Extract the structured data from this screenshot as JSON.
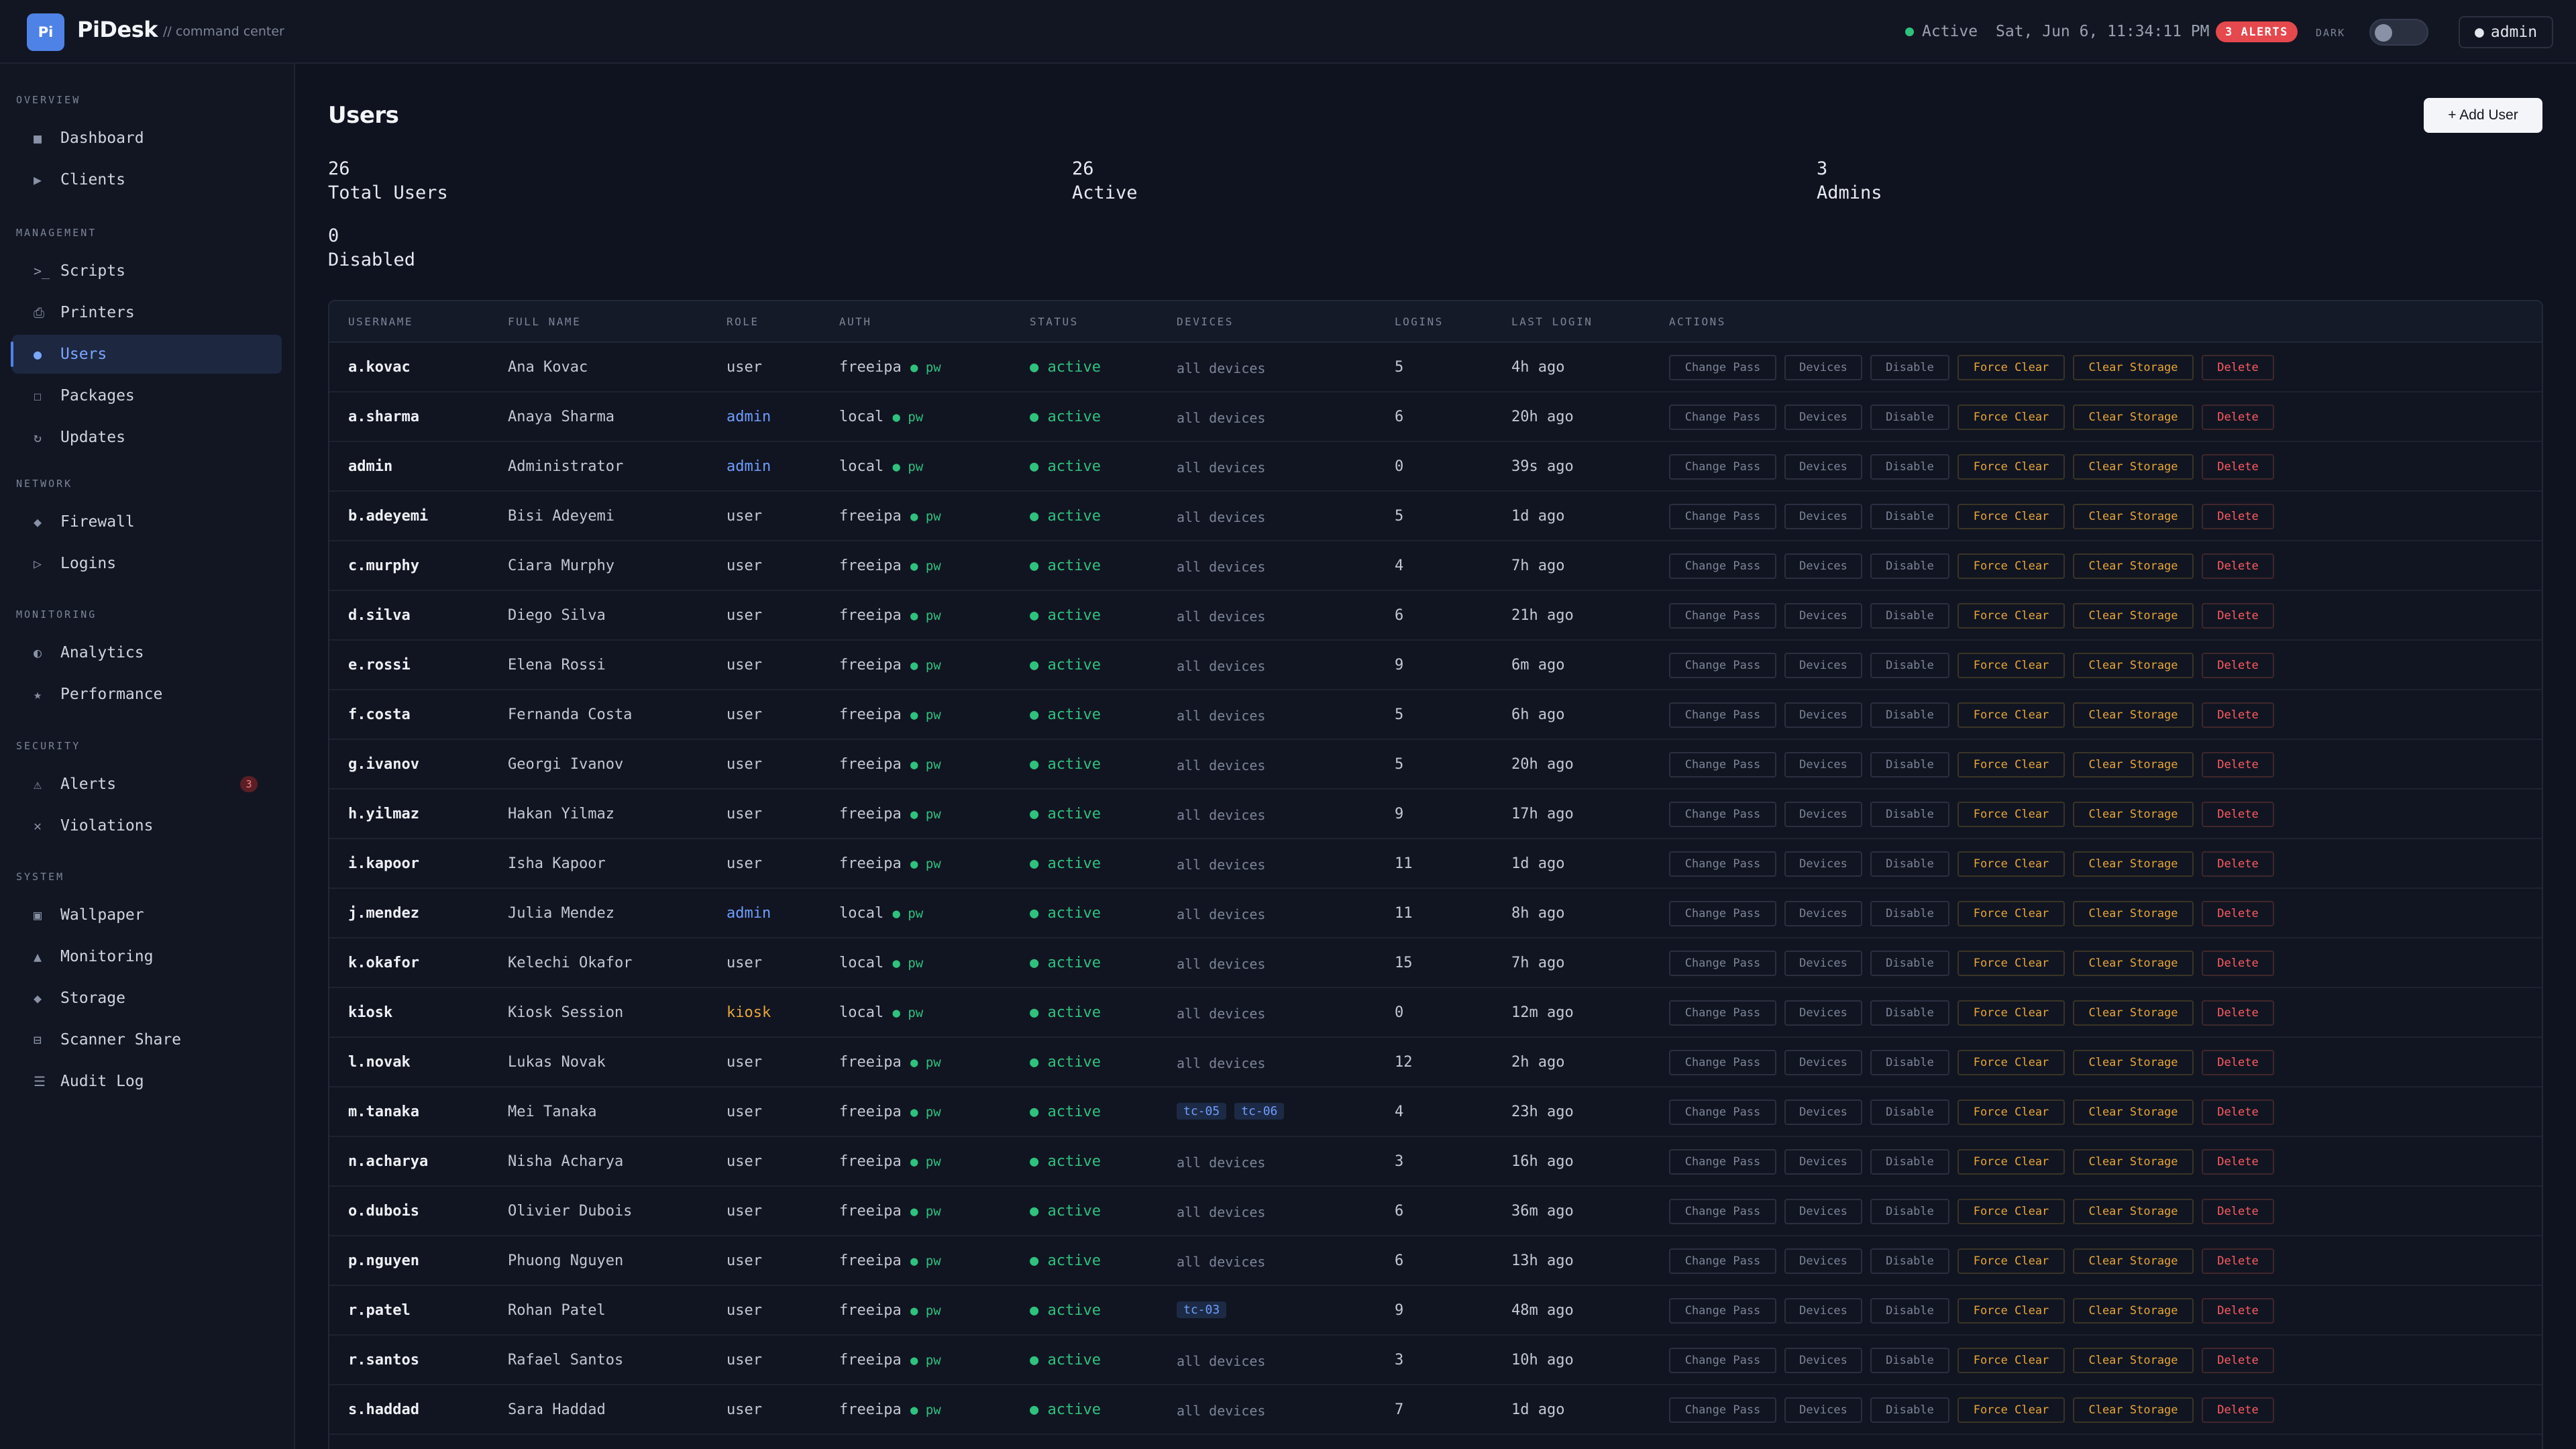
{
  "app": {
    "logo_text": "Pi",
    "brand": "PiDesk",
    "subtitle": "// command center",
    "status": "Active",
    "datetime": "Sat, Jun 6, 11:34:11 PM",
    "alerts_badge": "3 ALERTS",
    "theme_label": "DARK",
    "user_chip": "admin"
  },
  "colors": {
    "accent": "#4f82e6",
    "active_green": "#2ec27e",
    "admin_blue": "#6f9eff",
    "kiosk_orange": "#e8a63a",
    "danger_red": "#ff5c63"
  },
  "sidebar": {
    "sections": [
      {
        "title": "OVERVIEW",
        "items": [
          {
            "label": "Dashboard",
            "icon": "grid-icon",
            "glyph": "■"
          },
          {
            "label": "Clients",
            "icon": "play-icon",
            "glyph": "▶"
          }
        ]
      },
      {
        "title": "MANAGEMENT",
        "items": [
          {
            "label": "Scripts",
            "icon": "terminal-icon",
            "glyph": ">_"
          },
          {
            "label": "Printers",
            "icon": "printer-icon",
            "glyph": "⎙"
          },
          {
            "label": "Users",
            "icon": "user-icon",
            "glyph": "●",
            "active": true
          },
          {
            "label": "Packages",
            "icon": "package-icon",
            "glyph": "☐"
          },
          {
            "label": "Updates",
            "icon": "refresh-icon",
            "glyph": "↻"
          }
        ]
      },
      {
        "title": "NETWORK",
        "items": [
          {
            "label": "Firewall",
            "icon": "diamond-icon",
            "glyph": "◆"
          },
          {
            "label": "Logins",
            "icon": "triangle-icon",
            "glyph": "▷"
          }
        ]
      },
      {
        "title": "MONITORING",
        "items": [
          {
            "label": "Analytics",
            "icon": "half-circle-icon",
            "glyph": "◐"
          },
          {
            "label": "Performance",
            "icon": "star-icon",
            "glyph": "★"
          }
        ]
      },
      {
        "title": "SECURITY",
        "items": [
          {
            "label": "Alerts",
            "icon": "warning-icon",
            "glyph": "⚠",
            "badge": "3"
          },
          {
            "label": "Violations",
            "icon": "x-icon",
            "glyph": "✕"
          }
        ]
      },
      {
        "title": "SYSTEM",
        "items": [
          {
            "label": "Wallpaper",
            "icon": "image-icon",
            "glyph": "▣"
          },
          {
            "label": "Monitoring",
            "icon": "mountain-icon",
            "glyph": "▲"
          },
          {
            "label": "Storage",
            "icon": "storage-icon",
            "glyph": "◆"
          },
          {
            "label": "Scanner Share",
            "icon": "scanner-icon",
            "glyph": "⊟"
          },
          {
            "label": "Audit Log",
            "icon": "list-icon",
            "glyph": "☰"
          }
        ]
      }
    ]
  },
  "page": {
    "title": "Users",
    "add_button": "+ Add User",
    "stats": [
      {
        "value": "26",
        "label": "Total Users"
      },
      {
        "value": "26",
        "label": "Active"
      },
      {
        "value": "3",
        "label": "Admins"
      },
      {
        "value": "0",
        "label": "Disabled"
      }
    ]
  },
  "table": {
    "columns": [
      "USERNAME",
      "FULL NAME",
      "ROLE",
      "AUTH",
      "STATUS",
      "DEVICES",
      "LOGINS",
      "LAST LOGIN",
      "ACTIONS"
    ],
    "actions": [
      "Change Pass",
      "Devices",
      "Disable",
      "Force Clear",
      "Clear Storage",
      "Delete"
    ],
    "rows": [
      {
        "username": "a.kovac",
        "name": "Ana Kovac",
        "role": "user",
        "auth": "freeipa",
        "pw": "● pw",
        "status": "● active",
        "devices": "all devices",
        "logins": "5",
        "last": "4h ago"
      },
      {
        "username": "a.sharma",
        "name": "Anaya Sharma",
        "role": "admin",
        "auth": "local",
        "pw": "● pw",
        "status": "● active",
        "devices": "all devices",
        "logins": "6",
        "last": "20h ago"
      },
      {
        "username": "admin",
        "name": "Administrator",
        "role": "admin",
        "auth": "local",
        "pw": "● pw",
        "status": "● active",
        "devices": "all devices",
        "logins": "0",
        "last": "39s ago"
      },
      {
        "username": "b.adeyemi",
        "name": "Bisi Adeyemi",
        "role": "user",
        "auth": "freeipa",
        "pw": "● pw",
        "status": "● active",
        "devices": "all devices",
        "logins": "5",
        "last": "1d ago"
      },
      {
        "username": "c.murphy",
        "name": "Ciara Murphy",
        "role": "user",
        "auth": "freeipa",
        "pw": "● pw",
        "status": "● active",
        "devices": "all devices",
        "logins": "4",
        "last": "7h ago"
      },
      {
        "username": "d.silva",
        "name": "Diego Silva",
        "role": "user",
        "auth": "freeipa",
        "pw": "● pw",
        "status": "● active",
        "devices": "all devices",
        "logins": "6",
        "last": "21h ago"
      },
      {
        "username": "e.rossi",
        "name": "Elena Rossi",
        "role": "user",
        "auth": "freeipa",
        "pw": "● pw",
        "status": "● active",
        "devices": "all devices",
        "logins": "9",
        "last": "6m ago"
      },
      {
        "username": "f.costa",
        "name": "Fernanda Costa",
        "role": "user",
        "auth": "freeipa",
        "pw": "● pw",
        "status": "● active",
        "devices": "all devices",
        "logins": "5",
        "last": "6h ago"
      },
      {
        "username": "g.ivanov",
        "name": "Georgi Ivanov",
        "role": "user",
        "auth": "freeipa",
        "pw": "● pw",
        "status": "● active",
        "devices": "all devices",
        "logins": "5",
        "last": "20h ago"
      },
      {
        "username": "h.yilmaz",
        "name": "Hakan Yilmaz",
        "role": "user",
        "auth": "freeipa",
        "pw": "● pw",
        "status": "● active",
        "devices": "all devices",
        "logins": "9",
        "last": "17h ago"
      },
      {
        "username": "i.kapoor",
        "name": "Isha Kapoor",
        "role": "user",
        "auth": "freeipa",
        "pw": "● pw",
        "status": "● active",
        "devices": "all devices",
        "logins": "11",
        "last": "1d ago"
      },
      {
        "username": "j.mendez",
        "name": "Julia Mendez",
        "role": "admin",
        "auth": "local",
        "pw": "● pw",
        "status": "● active",
        "devices": "all devices",
        "logins": "11",
        "last": "8h ago"
      },
      {
        "username": "k.okafor",
        "name": "Kelechi Okafor",
        "role": "user",
        "auth": "local",
        "pw": "● pw",
        "status": "● active",
        "devices": "all devices",
        "logins": "15",
        "last": "7h ago"
      },
      {
        "username": "kiosk",
        "name": "Kiosk Session",
        "role": "kiosk",
        "auth": "local",
        "pw": "● pw",
        "status": "● active",
        "devices": "all devices",
        "logins": "0",
        "last": "12m ago"
      },
      {
        "username": "l.novak",
        "name": "Lukas Novak",
        "role": "user",
        "auth": "freeipa",
        "pw": "● pw",
        "status": "● active",
        "devices": "all devices",
        "logins": "12",
        "last": "2h ago"
      },
      {
        "username": "m.tanaka",
        "name": "Mei Tanaka",
        "role": "user",
        "auth": "freeipa",
        "pw": "● pw",
        "status": "● active",
        "devices": "",
        "device_tags": [
          "tc-05",
          "tc-06"
        ],
        "logins": "4",
        "last": "23h ago"
      },
      {
        "username": "n.acharya",
        "name": "Nisha Acharya",
        "role": "user",
        "auth": "freeipa",
        "pw": "● pw",
        "status": "● active",
        "devices": "all devices",
        "logins": "3",
        "last": "16h ago"
      },
      {
        "username": "o.dubois",
        "name": "Olivier Dubois",
        "role": "user",
        "auth": "freeipa",
        "pw": "● pw",
        "status": "● active",
        "devices": "all devices",
        "logins": "6",
        "last": "36m ago"
      },
      {
        "username": "p.nguyen",
        "name": "Phuong Nguyen",
        "role": "user",
        "auth": "freeipa",
        "pw": "● pw",
        "status": "● active",
        "devices": "all devices",
        "logins": "6",
        "last": "13h ago"
      },
      {
        "username": "r.patel",
        "name": "Rohan Patel",
        "role": "user",
        "auth": "freeipa",
        "pw": "● pw",
        "status": "● active",
        "devices": "",
        "device_tags": [
          "tc-03"
        ],
        "logins": "9",
        "last": "48m ago"
      },
      {
        "username": "r.santos",
        "name": "Rafael Santos",
        "role": "user",
        "auth": "freeipa",
        "pw": "● pw",
        "status": "● active",
        "devices": "all devices",
        "logins": "3",
        "last": "10h ago"
      },
      {
        "username": "s.haddad",
        "name": "Sara Haddad",
        "role": "user",
        "auth": "freeipa",
        "pw": "● pw",
        "status": "● active",
        "devices": "all devices",
        "logins": "7",
        "last": "1d ago"
      }
    ]
  }
}
